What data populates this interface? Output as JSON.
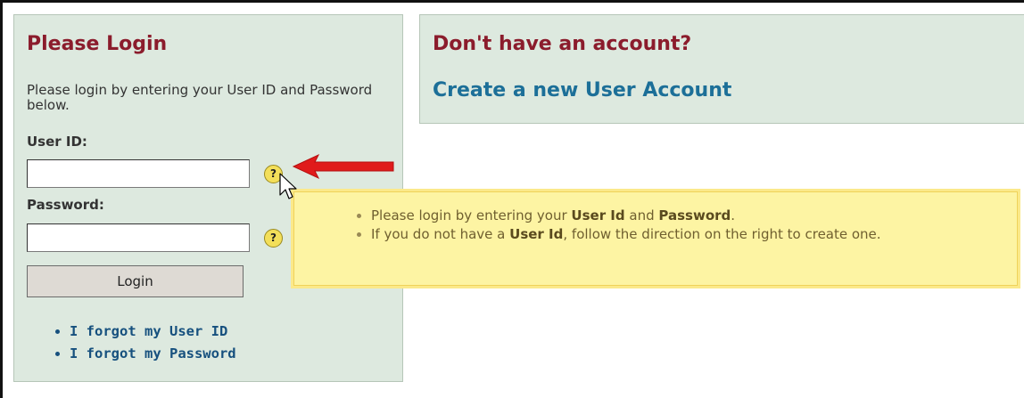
{
  "login": {
    "title": "Please Login",
    "intro": "Please login by entering your User ID and Password below.",
    "user_id_label": "User ID:",
    "user_id_value": "",
    "password_label": "Password:",
    "password_value": "",
    "help_glyph": "?",
    "login_button": "Login",
    "forgot_links": [
      "I forgot my User ID",
      "I forgot my Password"
    ]
  },
  "signup": {
    "title": "Don't have an account?",
    "link": "Create a new User Account"
  },
  "tooltip": {
    "line1": {
      "pre": "Please login by entering your ",
      "bold1": "User Id",
      "mid": " and ",
      "bold2": "Password",
      "post": "."
    },
    "line2": {
      "pre": "If you do not have a ",
      "bold1": "User Id",
      "post": ", follow the direction on the right to create one."
    }
  },
  "annotation": {
    "arrow_color": "#e01b1b",
    "pointer": "mouse-pointer-icon"
  },
  "colors": {
    "panel_bg": "#dde9df",
    "heading": "#8b1c2c",
    "link": "#1c6f98",
    "tooltip_bg": "#fdf4a3"
  }
}
